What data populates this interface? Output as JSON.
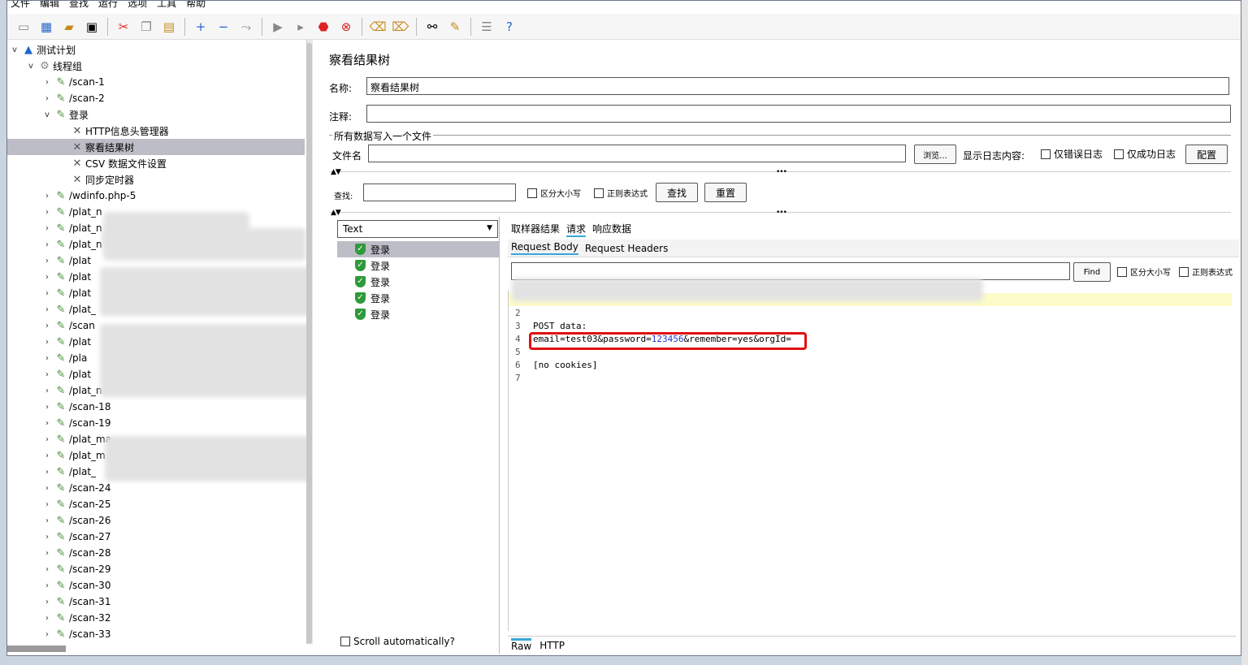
{
  "menu": [
    "文件",
    "编辑",
    "查找",
    "运行",
    "选项",
    "工具",
    "帮助"
  ],
  "toolbar": {
    "icons": [
      "new-icon",
      "templates-icon",
      "open-icon",
      "save-icon",
      "cut-icon",
      "copy-icon",
      "paste-icon",
      "expand-icon",
      "collapse-icon",
      "toggle-icon",
      "start-icon",
      "start-no-pause-icon",
      "stop-icon",
      "shutdown-icon",
      "clear-icon",
      "clear-all-icon",
      "search-icon",
      "reset-search-icon",
      "function-helper-icon",
      "help-icon"
    ]
  },
  "tree": {
    "root": "测试计划",
    "thread_group": "线程组",
    "items": [
      {
        "label": "/scan-1",
        "level": 2,
        "caret": ">"
      },
      {
        "label": "/scan-2",
        "level": 2,
        "caret": ">"
      },
      {
        "label": "登录",
        "level": 2,
        "caret": "v"
      },
      {
        "label": "HTTP信息头管理器",
        "level": 3,
        "caret": ""
      },
      {
        "label": "察看结果树",
        "level": 3,
        "caret": "",
        "selected": true
      },
      {
        "label": "CSV 数据文件设置",
        "level": 3,
        "caret": ""
      },
      {
        "label": "同步定时器",
        "level": 3,
        "caret": ""
      },
      {
        "label": "/wdinfo.php-5",
        "level": 2,
        "caret": ">"
      },
      {
        "label": "/plat_n",
        "level": 2,
        "caret": ">"
      },
      {
        "label": "/plat_n",
        "level": 2,
        "caret": ">"
      },
      {
        "label": "/plat_n",
        "level": 2,
        "caret": ">"
      },
      {
        "label": "/plat",
        "level": 2,
        "caret": ">"
      },
      {
        "label": "/plat",
        "level": 2,
        "caret": ">"
      },
      {
        "label": "/plat",
        "level": 2,
        "caret": ">"
      },
      {
        "label": "/plat_",
        "level": 2,
        "caret": ">"
      },
      {
        "label": "/scan",
        "level": 2,
        "caret": ">"
      },
      {
        "label": "/plat",
        "level": 2,
        "caret": ">"
      },
      {
        "label": "/pla",
        "level": 2,
        "caret": ">"
      },
      {
        "label": "/plat",
        "level": 2,
        "caret": ">"
      },
      {
        "label": "/plat_n",
        "level": 2,
        "caret": ">"
      },
      {
        "label": "/scan-18",
        "level": 2,
        "caret": ">"
      },
      {
        "label": "/scan-19",
        "level": 2,
        "caret": ">"
      },
      {
        "label": "/plat_ma",
        "level": 2,
        "caret": ">"
      },
      {
        "label": "/plat_m",
        "level": 2,
        "caret": ">"
      },
      {
        "label": "/plat_",
        "level": 2,
        "caret": ">"
      },
      {
        "label": "/scan-24",
        "level": 2,
        "caret": ">"
      },
      {
        "label": "/scan-25",
        "level": 2,
        "caret": ">"
      },
      {
        "label": "/scan-26",
        "level": 2,
        "caret": ">"
      },
      {
        "label": "/scan-27",
        "level": 2,
        "caret": ">"
      },
      {
        "label": "/scan-28",
        "level": 2,
        "caret": ">"
      },
      {
        "label": "/scan-29",
        "level": 2,
        "caret": ">"
      },
      {
        "label": "/scan-30",
        "level": 2,
        "caret": ">"
      },
      {
        "label": "/scan-31",
        "level": 2,
        "caret": ">"
      },
      {
        "label": "/scan-32",
        "level": 2,
        "caret": ">"
      },
      {
        "label": "/scan-33",
        "level": 2,
        "caret": ">"
      }
    ]
  },
  "panel": {
    "title": "察看结果树",
    "name_label": "名称:",
    "name_value": "察看结果树",
    "comment_label": "注释:",
    "comment_value": "",
    "file_section": "所有数据写入一个文件",
    "filename_label": "文件名",
    "filename_value": "",
    "browse_button": "浏览...",
    "log_label": "显示日志内容:",
    "errors_only": "仅错误日志",
    "success_only": "仅成功日志",
    "config_button": "配置",
    "search_label": "查找:",
    "search_value": "",
    "case_sensitive": "区分大小写",
    "regex": "正则表达式",
    "find_button": "查找",
    "reset_button": "重置"
  },
  "results": {
    "renderer": "Text",
    "items": [
      "登录",
      "登录",
      "登录",
      "登录",
      "登录"
    ],
    "scroll_auto": "Scroll automatically?"
  },
  "detail": {
    "tabs": [
      "取样器结果",
      "请求",
      "响应数据"
    ],
    "active_tab": "请求",
    "subtabs": [
      "Request Body",
      "Request Headers"
    ],
    "active_subtab": "Request Body",
    "find_value": "",
    "find_button": "Find",
    "case_sensitive": "区分大小写",
    "regex": "正则表达式",
    "line_numbers": [
      "2",
      "3",
      "4",
      "5",
      "6",
      "7"
    ],
    "code": {
      "line3": "POST data:",
      "line4_pre1": "email=test03&password=",
      "line4_num": "123456",
      "line4_post": "&remember=yes&orgId=",
      "line6": "[no cookies]"
    },
    "bottom_tabs": [
      "Raw",
      "HTTP"
    ],
    "active_bottom": "Raw"
  },
  "colors": {
    "selection": "#bdbdc7",
    "accent": "#3aa7d8",
    "highlight_box": "#e01010",
    "success_green": "#2e9a3a"
  }
}
